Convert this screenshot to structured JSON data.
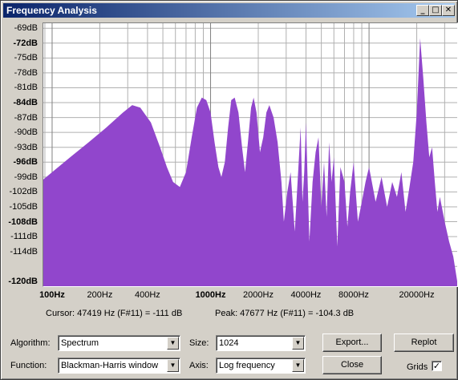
{
  "window": {
    "title": "Frequency Analysis"
  },
  "titlebar_buttons": [
    "_",
    "□",
    "✕"
  ],
  "chart_data": {
    "type": "area",
    "x_scale": "log",
    "xlim": [
      88,
      36000
    ],
    "ylim": [
      -121,
      -68
    ],
    "y_ticks": [
      {
        "v": -69,
        "label": "-69dB",
        "bold": false
      },
      {
        "v": -72,
        "label": "-72dB",
        "bold": true
      },
      {
        "v": -75,
        "label": "-75dB",
        "bold": false
      },
      {
        "v": -78,
        "label": "-78dB",
        "bold": false
      },
      {
        "v": -81,
        "label": "-81dB",
        "bold": false
      },
      {
        "v": -84,
        "label": "-84dB",
        "bold": true
      },
      {
        "v": -87,
        "label": "-87dB",
        "bold": false
      },
      {
        "v": -90,
        "label": "-90dB",
        "bold": false
      },
      {
        "v": -93,
        "label": "-93dB",
        "bold": false
      },
      {
        "v": -96,
        "label": "-96dB",
        "bold": true
      },
      {
        "v": -99,
        "label": "-99dB",
        "bold": false
      },
      {
        "v": -102,
        "label": "-102dB",
        "bold": false
      },
      {
        "v": -105,
        "label": "-105dB",
        "bold": false
      },
      {
        "v": -108,
        "label": "-108dB",
        "bold": true
      },
      {
        "v": -111,
        "label": "-111dB",
        "bold": false
      },
      {
        "v": -114,
        "label": "-114dB",
        "bold": false
      },
      {
        "v": -120,
        "label": "-120dB",
        "bold": true
      }
    ],
    "x_ticks": [
      {
        "v": 100,
        "label": "100Hz",
        "bold": true
      },
      {
        "v": 200,
        "label": "200Hz",
        "bold": false
      },
      {
        "v": 400,
        "label": "400Hz",
        "bold": false
      },
      {
        "v": 1000,
        "label": "1000Hz",
        "bold": true
      },
      {
        "v": 2000,
        "label": "2000Hz",
        "bold": false
      },
      {
        "v": 4000,
        "label": "4000Hz",
        "bold": false
      },
      {
        "v": 8000,
        "label": "8000Hz",
        "bold": false
      },
      {
        "v": 20000,
        "label": "20000Hz",
        "bold": false
      }
    ],
    "series": [
      {
        "color": "#9146cc",
        "x": [
          88,
          100,
          130,
          170,
          220,
          280,
          320,
          360,
          420,
          480,
          530,
          580,
          640,
          700,
          760,
          820,
          880,
          940,
          1000,
          1060,
          1120,
          1170,
          1230,
          1290,
          1350,
          1420,
          1500,
          1580,
          1650,
          1720,
          1800,
          1870,
          1950,
          2050,
          2150,
          2250,
          2350,
          2500,
          2650,
          2800,
          2900,
          3050,
          3200,
          3400,
          3600,
          3700,
          3800,
          3900,
          4000,
          4200,
          4400,
          4600,
          4800,
          5000,
          5200,
          5400,
          5600,
          5800,
          6000,
          6300,
          6600,
          7000,
          7300,
          7600,
          8000,
          8500,
          9000,
          9500,
          10000,
          11000,
          12000,
          13000,
          14000,
          15000,
          16000,
          17000,
          18000,
          19000,
          20000,
          21000,
          22000,
          23000,
          24000,
          25000,
          26000,
          27000,
          28000,
          30000,
          32000,
          34000,
          36000
        ],
        "y": [
          -99.5,
          -98,
          -95,
          -92,
          -89,
          -86,
          -84.5,
          -85,
          -88,
          -93,
          -97,
          -100,
          -101,
          -98,
          -91,
          -85,
          -83,
          -83.5,
          -86,
          -92,
          -97,
          -99,
          -96,
          -89,
          -83.5,
          -83,
          -86,
          -93,
          -98,
          -92,
          -85,
          -83,
          -86,
          -94,
          -91,
          -86,
          -84.5,
          -87,
          -92,
          -100,
          -108,
          -102,
          -98,
          -110,
          -96,
          -89,
          -104,
          -98,
          -88,
          -112,
          -100,
          -94,
          -91,
          -105,
          -96,
          -107,
          -92,
          -100,
          -95,
          -113,
          -97,
          -100,
          -109,
          -102,
          -96,
          -108,
          -104,
          -100,
          -97,
          -104,
          -99,
          -105,
          -100,
          -103,
          -98,
          -106,
          -101,
          -96,
          -86,
          -71,
          -79,
          -88,
          -95,
          -93,
          -100,
          -106,
          -103,
          -108,
          -112,
          -115,
          -120
        ]
      }
    ]
  },
  "status": {
    "cursor": "Cursor: 47419 Hz (F#11) = -111 dB",
    "peak": "Peak: 47677 Hz (F#11) = -104.3 dB"
  },
  "controls": {
    "algorithm_label": "Algorithm:",
    "algorithm_value": "Spectrum",
    "function_label": "Function:",
    "function_value": "Blackman-Harris window",
    "size_label": "Size:",
    "size_value": "1024",
    "axis_label": "Axis:",
    "axis_value": "Log frequency",
    "export_label": "Export...",
    "close_label": "Close",
    "replot_label": "Replot",
    "grids_label": "Grids",
    "grids_checked": "✓"
  }
}
